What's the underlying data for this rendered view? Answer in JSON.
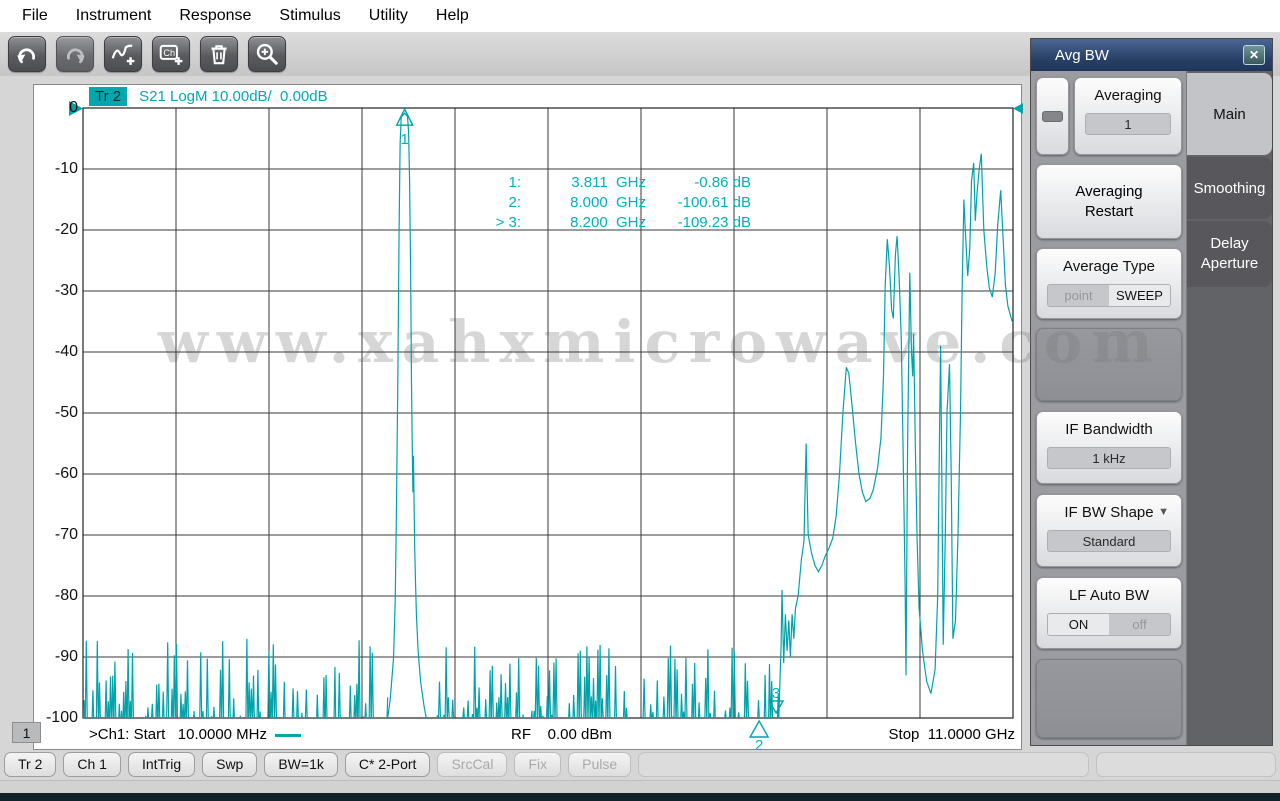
{
  "menu": {
    "items": [
      "File",
      "Instrument",
      "Response",
      "Stimulus",
      "Utility",
      "Help"
    ]
  },
  "toolbar": {
    "buttons": [
      {
        "icon": "undo-icon",
        "enabled": true
      },
      {
        "icon": "redo-icon",
        "enabled": false
      },
      {
        "icon": "add-trace-icon",
        "enabled": true
      },
      {
        "icon": "add-channel-icon",
        "enabled": true
      },
      {
        "icon": "delete-icon",
        "enabled": true
      },
      {
        "icon": "zoom-icon",
        "enabled": true
      }
    ]
  },
  "plot": {
    "trace_badge": "Tr 2",
    "trace_title": "S21 LogM 10.00dB/  0.00dB",
    "markers_readout": [
      {
        "id": "1:",
        "freq": "3.811  GHz",
        "value": "-0.86 dB"
      },
      {
        "id": "2:",
        "freq": "8.000  GHz",
        "value": "-100.61 dB"
      },
      {
        "id": "> 3:",
        "freq": "8.200  GHz",
        "value": "-109.23 dB"
      }
    ],
    "footer": {
      "channel_badge": "1",
      "start_label": ">Ch1: Start   10.0000 MHz",
      "rf_label": "RF    0.00 dBm",
      "stop_label": "Stop  11.0000 GHz"
    },
    "watermark": "www.xahxmicrowave.com"
  },
  "chart_data": {
    "type": "line",
    "title": "S21 LogM 10.00dB/ 0.00dB",
    "x_unit": "GHz",
    "x_range": [
      0.01,
      11.0
    ],
    "y_unit": "dB",
    "y_range": [
      -100,
      0
    ],
    "y_step": 10,
    "grid": true,
    "trace_color": "#00a3a9",
    "accent_text_color": "#00b1bd",
    "y_tick_labels": [
      "0",
      "-10",
      "-20",
      "-30",
      "-40",
      "-50",
      "-60",
      "-70",
      "-80",
      "-90",
      "-100"
    ],
    "markers": [
      {
        "n": "1",
        "freq_ghz": 3.811,
        "db": -0.86,
        "style": "on-trace"
      },
      {
        "n": "2",
        "freq_ghz": 8.0,
        "db": -100.61,
        "style": "below-axis"
      },
      {
        "n": "3",
        "freq_ghz": 8.2,
        "db": -109.23,
        "style": "clamped-bottom"
      }
    ],
    "noise_segments": [
      {
        "f1": 0.01,
        "f2": 3.6,
        "floor_db": -103,
        "peak_db": -87
      },
      {
        "f1": 4.08,
        "f2": 8.23,
        "floor_db": -102.5,
        "peak_db": -88
      }
    ],
    "feature_points": {
      "passband": [
        [
          3.6,
          -101
        ],
        [
          3.64,
          -97
        ],
        [
          3.68,
          -90
        ],
        [
          3.7,
          -80
        ],
        [
          3.715,
          -65
        ],
        [
          3.73,
          -45
        ],
        [
          3.745,
          -20
        ],
        [
          3.757,
          -6
        ],
        [
          3.77,
          -1.5
        ],
        [
          3.811,
          -0.86
        ],
        [
          3.845,
          -1.4
        ],
        [
          3.858,
          -4
        ],
        [
          3.87,
          -12
        ],
        [
          3.882,
          -28
        ],
        [
          3.892,
          -45
        ],
        [
          3.9,
          -55
        ],
        [
          3.908,
          -63
        ],
        [
          3.916,
          -57
        ],
        [
          3.922,
          -64
        ],
        [
          3.93,
          -72
        ],
        [
          3.938,
          -77
        ],
        [
          3.95,
          -83
        ],
        [
          3.97,
          -89
        ],
        [
          4.0,
          -94
        ],
        [
          4.04,
          -98
        ],
        [
          4.08,
          -101
        ]
      ],
      "high_band": [
        [
          8.23,
          -101
        ],
        [
          8.26,
          -88
        ],
        [
          8.27,
          -79
        ],
        [
          8.29,
          -91
        ],
        [
          8.31,
          -83
        ],
        [
          8.33,
          -89
        ],
        [
          8.35,
          -84
        ],
        [
          8.37,
          -90
        ],
        [
          8.39,
          -83
        ],
        [
          8.41,
          -87
        ],
        [
          8.43,
          -82
        ],
        [
          8.46,
          -80
        ],
        [
          8.5,
          -74
        ],
        [
          8.53,
          -71
        ],
        [
          8.555,
          -55
        ],
        [
          8.58,
          -70
        ],
        [
          8.62,
          -73
        ],
        [
          8.66,
          -75
        ],
        [
          8.7,
          -76
        ],
        [
          8.74,
          -75
        ],
        [
          8.78,
          -73.5
        ],
        [
          8.83,
          -72
        ],
        [
          8.87,
          -70.5
        ],
        [
          8.91,
          -67
        ],
        [
          8.95,
          -60
        ],
        [
          8.99,
          -50
        ],
        [
          9.03,
          -42.5
        ],
        [
          9.06,
          -43.5
        ],
        [
          9.1,
          -49
        ],
        [
          9.14,
          -55
        ],
        [
          9.18,
          -60
        ],
        [
          9.22,
          -63
        ],
        [
          9.26,
          -64.5
        ],
        [
          9.31,
          -64
        ],
        [
          9.35,
          -62.5
        ],
        [
          9.4,
          -59
        ],
        [
          9.44,
          -54
        ],
        [
          9.47,
          -44
        ],
        [
          9.49,
          -29
        ],
        [
          9.515,
          -21.5
        ],
        [
          9.54,
          -26
        ],
        [
          9.565,
          -33
        ],
        [
          9.585,
          -34.5
        ],
        [
          9.61,
          -24
        ],
        [
          9.63,
          -21
        ],
        [
          9.655,
          -28
        ],
        [
          9.68,
          -38
        ],
        [
          9.7,
          -55
        ],
        [
          9.725,
          -78
        ],
        [
          9.735,
          -93
        ],
        [
          9.755,
          -55
        ],
        [
          9.78,
          -27
        ],
        [
          9.8,
          -40
        ],
        [
          9.815,
          -44
        ],
        [
          9.825,
          -37
        ],
        [
          9.845,
          -55
        ],
        [
          9.865,
          -70
        ],
        [
          9.89,
          -82
        ],
        [
          9.93,
          -89
        ],
        [
          9.98,
          -94
        ],
        [
          10.03,
          -96
        ],
        [
          10.08,
          -92
        ],
        [
          10.11,
          -80
        ],
        [
          10.13,
          -55
        ],
        [
          10.145,
          -39
        ],
        [
          10.16,
          -62
        ],
        [
          10.175,
          -88
        ],
        [
          10.2,
          -70
        ],
        [
          10.22,
          -50
        ],
        [
          10.25,
          -42
        ],
        [
          10.27,
          -60
        ],
        [
          10.29,
          -87
        ],
        [
          10.32,
          -84
        ],
        [
          10.35,
          -70
        ],
        [
          10.38,
          -50
        ],
        [
          10.4,
          -29
        ],
        [
          10.42,
          -15
        ],
        [
          10.44,
          -21
        ],
        [
          10.465,
          -27.5
        ],
        [
          10.49,
          -23
        ],
        [
          10.51,
          -12
        ],
        [
          10.535,
          -9
        ],
        [
          10.555,
          -18.5
        ],
        [
          10.575,
          -14
        ],
        [
          10.6,
          -10
        ],
        [
          10.625,
          -7.5
        ],
        [
          10.655,
          -20
        ],
        [
          10.69,
          -26
        ],
        [
          10.72,
          -29.5
        ],
        [
          10.755,
          -31
        ],
        [
          10.79,
          -27
        ],
        [
          10.82,
          -19
        ],
        [
          10.855,
          -13.5
        ],
        [
          10.885,
          -22
        ],
        [
          10.91,
          -29
        ],
        [
          10.94,
          -32.5
        ],
        [
          10.97,
          -34
        ],
        [
          10.99,
          -35
        ]
      ]
    }
  },
  "panel": {
    "title": "Avg BW",
    "close_icon": "✕",
    "tabs": [
      {
        "label": "Main",
        "active": true
      },
      {
        "label": "Smoothing",
        "active": false
      },
      {
        "label": "Delay Aperture",
        "active": false
      }
    ],
    "controls": {
      "averaging_label": "Averaging",
      "averaging_value": "1",
      "averaging_restart_label": "Averaging Restart",
      "average_type_label": "Average Type",
      "average_type_options": [
        "point",
        "SWEEP"
      ],
      "average_type_selected": "SWEEP",
      "if_bandwidth_label": "IF Bandwidth",
      "if_bandwidth_value": "1 kHz",
      "if_bw_shape_label": "IF BW Shape",
      "if_bw_shape_value": "Standard",
      "lf_auto_bw_label": "LF Auto BW",
      "lf_auto_bw_options": [
        "ON",
        "off"
      ],
      "lf_auto_bw_selected": "ON"
    }
  },
  "status_bar": {
    "buttons": [
      {
        "label": "Tr 2",
        "enabled": true
      },
      {
        "label": "Ch 1",
        "enabled": true
      },
      {
        "label": "IntTrig",
        "enabled": true
      },
      {
        "label": "Swp",
        "enabled": true
      },
      {
        "label": "BW=1k",
        "enabled": true
      },
      {
        "label": "C* 2-Port",
        "enabled": true
      },
      {
        "label": "SrcCal",
        "enabled": false
      },
      {
        "label": "Fix",
        "enabled": false
      },
      {
        "label": "Pulse",
        "enabled": false
      }
    ]
  }
}
